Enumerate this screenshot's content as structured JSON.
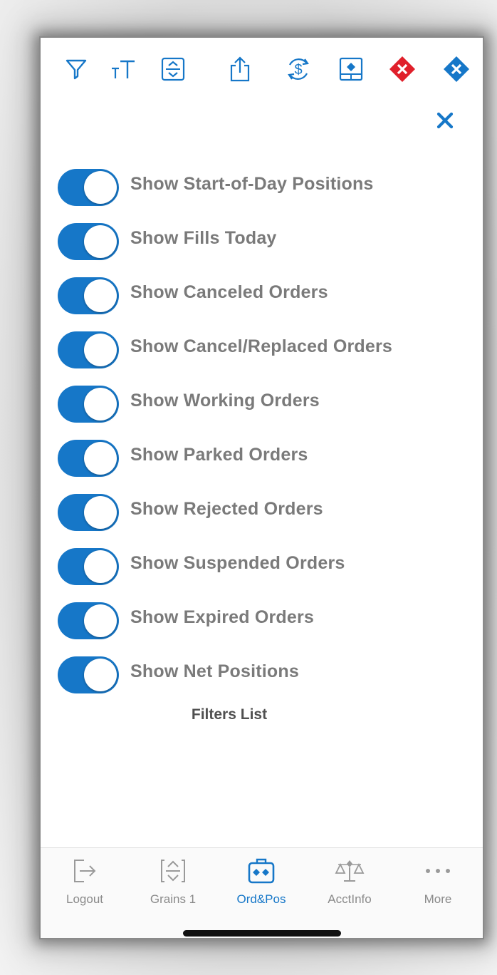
{
  "colors": {
    "accent": "#1677c8",
    "danger": "#e0202b",
    "label_gray": "#7a7a7a",
    "tab_inactive": "#8a8a8a"
  },
  "toolbar": {
    "icons": [
      "filter-icon",
      "text-size-icon",
      "expand-collapse-icon",
      "share-icon",
      "dollar-refresh-icon",
      "window-pane-icon",
      "cancel-all-diamond-icon",
      "cancel-diamond-icon"
    ]
  },
  "filters": [
    {
      "label": "Show Start-of-Day Positions",
      "on": true
    },
    {
      "label": "Show Fills Today",
      "on": true
    },
    {
      "label": "Show Canceled Orders",
      "on": true
    },
    {
      "label": "Show Cancel/Replaced Orders",
      "on": true
    },
    {
      "label": "Show Working Orders",
      "on": true
    },
    {
      "label": "Show Parked Orders",
      "on": true
    },
    {
      "label": "Show Rejected Orders",
      "on": true
    },
    {
      "label": "Show Suspended Orders",
      "on": true
    },
    {
      "label": "Show Expired Orders",
      "on": true
    },
    {
      "label": "Show Net Positions",
      "on": true
    }
  ],
  "caption": "Filters List",
  "tabbar": {
    "tabs": [
      {
        "label": "Logout",
        "icon": "logout-icon",
        "active": false
      },
      {
        "label": "Grains 1",
        "icon": "grains-icon",
        "active": false
      },
      {
        "label": "Ord&Pos",
        "icon": "orders-positions-icon",
        "active": true
      },
      {
        "label": "AcctInfo",
        "icon": "balance-scale-icon",
        "active": false
      },
      {
        "label": "More",
        "icon": "more-dots-icon",
        "active": false
      }
    ]
  }
}
